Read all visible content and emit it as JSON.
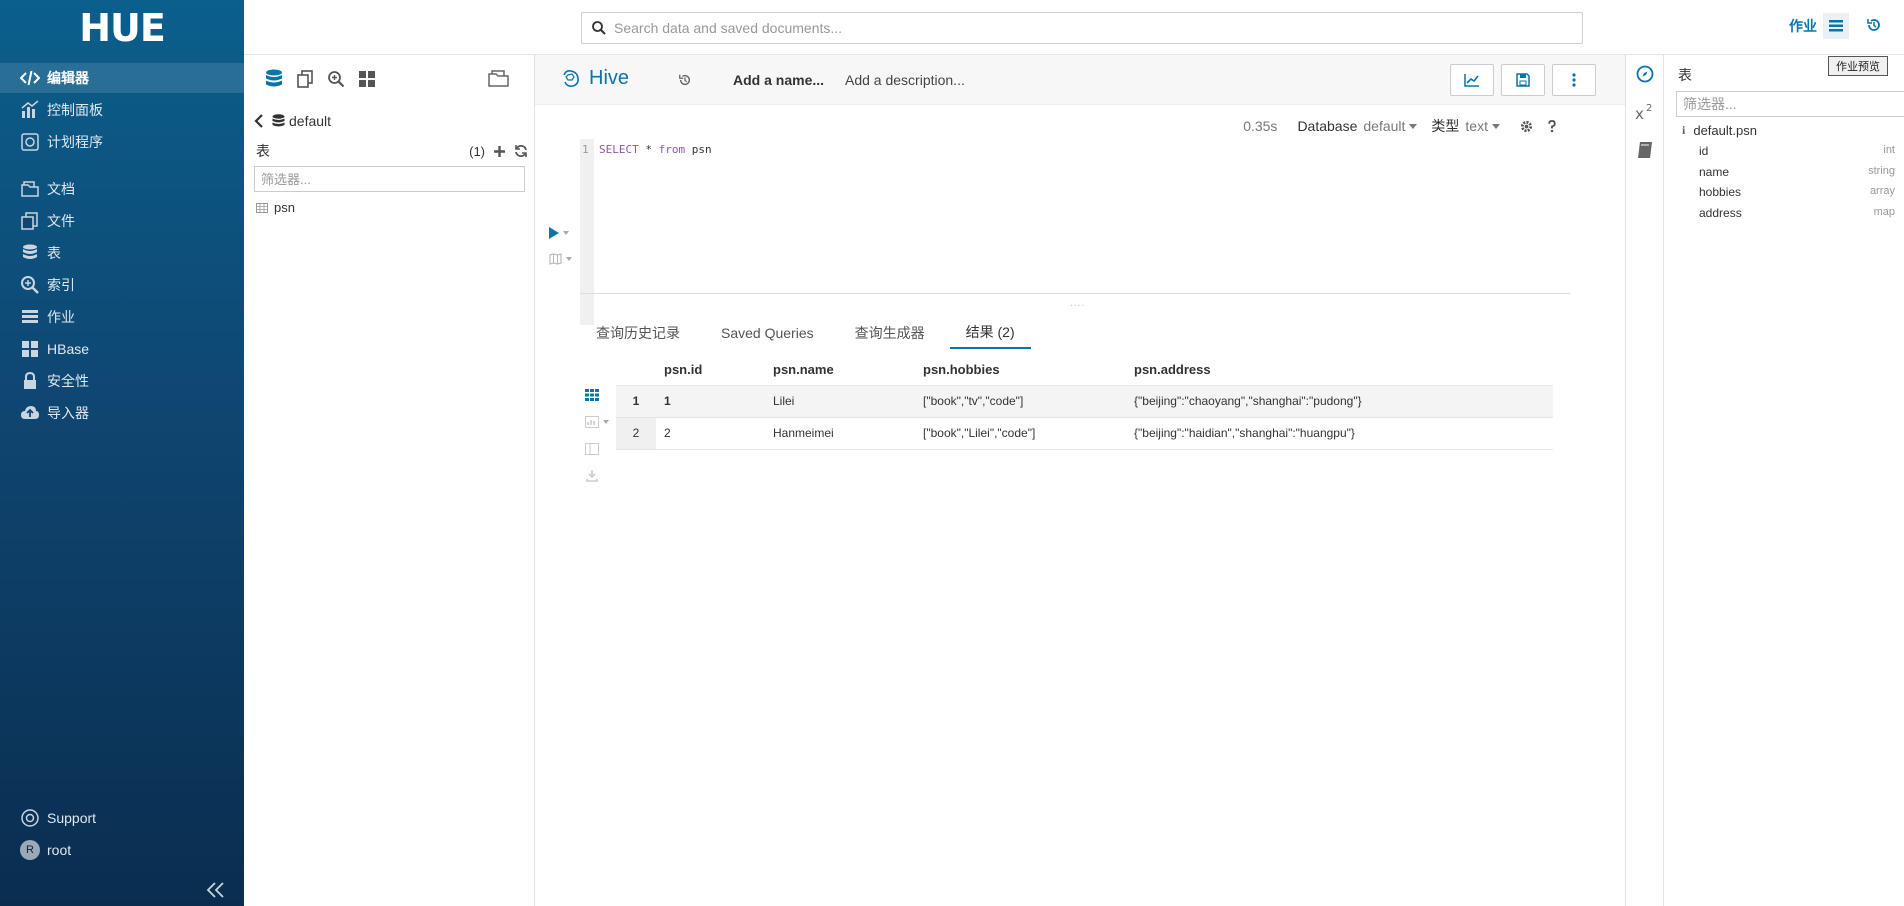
{
  "app": {
    "logo_text": "HUE"
  },
  "nav": {
    "items": [
      {
        "label": "编辑器",
        "icon": "code-icon",
        "active": true
      },
      {
        "label": "控制面板",
        "icon": "chart-icon"
      },
      {
        "label": "计划程序",
        "icon": "scheduler-icon"
      },
      {
        "label": "文档",
        "icon": "documents-icon"
      },
      {
        "label": "文件",
        "icon": "files-icon"
      },
      {
        "label": "表",
        "icon": "database-icon"
      },
      {
        "label": "索引",
        "icon": "index-search-icon"
      },
      {
        "label": "作业",
        "icon": "jobs-icon"
      },
      {
        "label": "HBase",
        "icon": "hbase-icon"
      },
      {
        "label": "安全性",
        "icon": "lock-icon"
      },
      {
        "label": "导入器",
        "icon": "cloud-upload-icon"
      }
    ],
    "support": "Support",
    "user": {
      "name": "root",
      "initial": "R"
    }
  },
  "topbar": {
    "search_placeholder": "Search data and saved documents...",
    "jobs_label": "作业"
  },
  "assist": {
    "database": "default",
    "tables_label": "表",
    "tables_count": "(1)",
    "filter_placeholder": "筛选器...",
    "tables": [
      "psn"
    ]
  },
  "editor": {
    "type": "Hive",
    "name_placeholder": "Add a name...",
    "description_placeholder": "Add a description...",
    "exec_time": "0.35s",
    "database_label": "Database",
    "database_value": "default",
    "type_label": "类型",
    "type_value": "text",
    "line_number": "1",
    "code": {
      "select": "SELECT",
      "rest1": " * ",
      "from": "from",
      "rest2": " psn"
    },
    "split_dots": "....",
    "result_tabs": [
      "查询历史记录",
      "Saved Queries",
      "查询生成器",
      "结果 (2)"
    ],
    "active_tab": 3
  },
  "results": {
    "columns": [
      "psn.id",
      "psn.name",
      "psn.hobbies",
      "psn.address"
    ],
    "rows": [
      {
        "n": "1",
        "cells": [
          "1",
          "Lilei",
          "[\"book\",\"tv\",\"code\"]",
          "{\"beijing\":\"chaoyang\",\"shanghai\":\"pudong\"}"
        ]
      },
      {
        "n": "2",
        "cells": [
          "2",
          "Hanmeimei",
          "[\"book\",\"Lilei\",\"code\"]",
          "{\"beijing\":\"haidian\",\"shanghai\":\"huangpu\"}"
        ]
      }
    ]
  },
  "right_assist": {
    "title": "表",
    "filter_placeholder": "筛选器...",
    "table_name": "default.psn",
    "info_glyph": "i",
    "columns": [
      {
        "name": "id",
        "type": "int"
      },
      {
        "name": "name",
        "type": "string"
      },
      {
        "name": "hobbies",
        "type": "array"
      },
      {
        "name": "address",
        "type": "map"
      }
    ],
    "tooltip": "作业预览"
  },
  "colors": {
    "accent": "#0b74a8",
    "nav_top": "#0b5f8c",
    "nav_bottom": "#0a2d4f"
  }
}
